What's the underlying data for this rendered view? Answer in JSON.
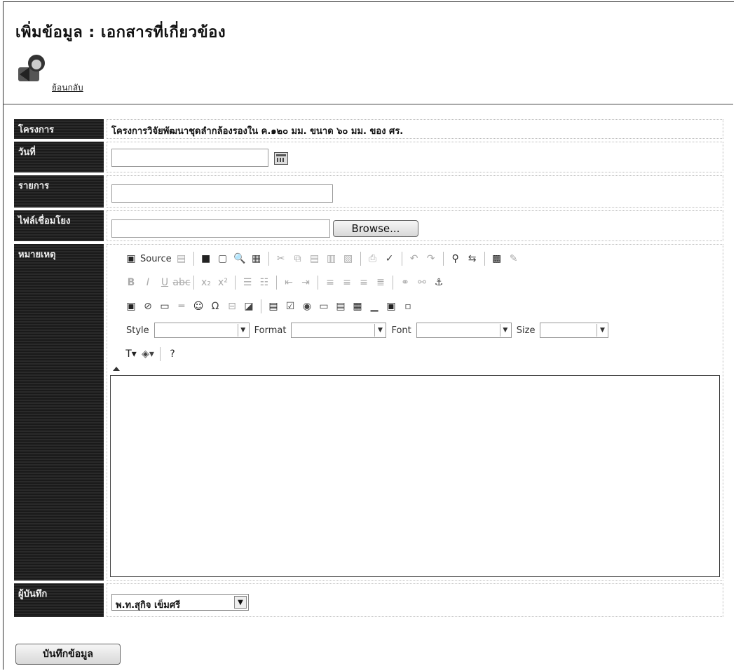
{
  "page": {
    "title": "เพิ่มข้อมูล : เอกสารที่เกี่ยวข้อง",
    "back_label": "ย้อนกลับ"
  },
  "form": {
    "project_label": "โครงการ",
    "project_value": "โครงการวิจัยพัฒนาชุดลำกล้องรองใน ค.๑๒๐ มม. ขนาด ๖๐ มม. ของ ศร.",
    "date_label": "วันที่",
    "date_value": "",
    "item_label": "รายการ",
    "item_value": "",
    "file_label": "ไฟล์เชื่อมโยง",
    "file_value": "",
    "browse_label": "Browse...",
    "note_label": "หมายเหตุ",
    "recorder_label": "ผู้บันทึก",
    "recorder_value": "พ.ท.สุกิจ เข็มศรี",
    "save_label": "บันทึกข้อมูล"
  },
  "editor": {
    "source_label": "Source",
    "style_label": "Style",
    "format_label": "Format",
    "font_label": "Font",
    "size_label": "Size",
    "style_value": "",
    "format_value": "",
    "font_value": "",
    "size_value": ""
  }
}
